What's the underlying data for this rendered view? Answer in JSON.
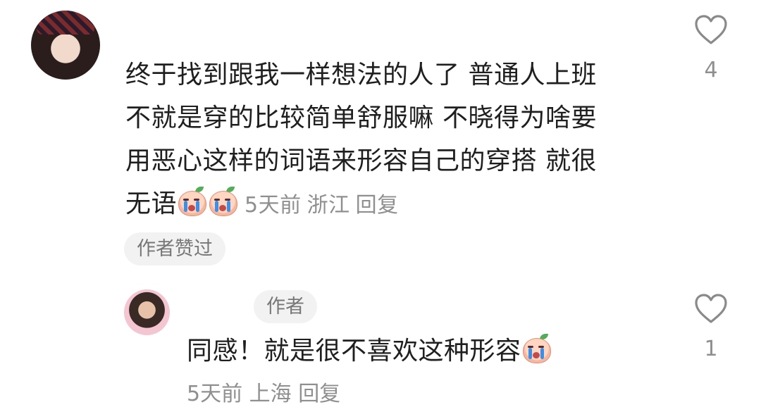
{
  "comment": {
    "lines": [
      "终于找到跟我一样想法的人了   普通人上班",
      "不就是穿的比较简单舒服嘛  不晓得为啥要",
      "用恶心这样的词语来形容自己的穿搭 就很",
      "无语"
    ],
    "time": "5天前",
    "location": "浙江",
    "reply_label": "回复",
    "author_liked_label": "作者赞过",
    "like_count": "4"
  },
  "reply": {
    "author_badge": "作者",
    "text": "同感！就是很不喜欢这种形容",
    "time": "5天前",
    "location": "上海",
    "reply_label": "回复",
    "like_count": "1"
  },
  "icons": {
    "like": "heart-outline-icon",
    "emoji": "crying-emoji-icon",
    "avatar_commenter": "avatar",
    "avatar_author": "avatar"
  },
  "colors": {
    "text": "#1f1f1f",
    "meta": "#8f8f8f",
    "chip_bg": "#f2f2f2"
  }
}
